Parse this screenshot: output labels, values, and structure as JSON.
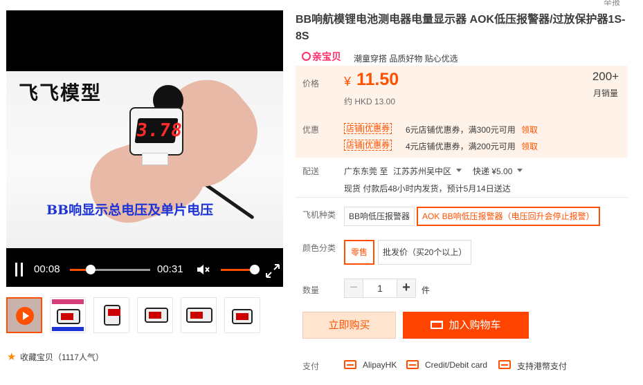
{
  "video": {
    "caption_top": "飞飞模型",
    "caption_bottom": "BB响显示总电压及单片电压",
    "display_reading": "3.78",
    "time_current": "00:08",
    "time_duration": "00:31",
    "progress_fraction": 0.26,
    "volume_fraction": 0.85
  },
  "thumbnails": [
    {
      "name": "video-thumb",
      "kind": "video"
    },
    {
      "name": "image-thumb-1"
    },
    {
      "name": "image-thumb-2"
    },
    {
      "name": "image-thumb-3"
    },
    {
      "name": "image-thumb-4"
    },
    {
      "name": "image-thumb-5"
    }
  ],
  "favorite": {
    "icon": "star-icon",
    "label": "收藏宝贝（1117人气）"
  },
  "top_cut_text": "举报",
  "product": {
    "title": "BB响航模锂电池测电器电量显示器 AOK低压报警器/过放保护器1S-8S",
    "brand_logo": "亲宝贝",
    "brand_slogan": "潮童穿搭 品质好物 贴心优选"
  },
  "price": {
    "label": "价格",
    "symbol": "¥",
    "value": "11.50",
    "hkd": "约 HKD 13.00",
    "sales_count": "200+",
    "sales_label": "月销量"
  },
  "coupons": {
    "label": "优惠",
    "items": [
      {
        "tag": "店铺|优惠券",
        "text": "6元店铺优惠券，满300元可用",
        "action": "领取"
      },
      {
        "tag": "店铺|优惠券",
        "text": "4元店铺优惠券，满200元可用",
        "action": "领取"
      }
    ]
  },
  "shipping": {
    "label": "配送",
    "from": "广东东莞 至",
    "to": "江苏苏州吴中区",
    "express": "快递 ¥5.00",
    "note": "现货 付款后48小时内发货，预计5月14日送达"
  },
  "options": {
    "model_label": "飞机种类",
    "models": [
      "BB响低压报警器",
      "AOK BB响低压报警器（电压回升会停止报警）"
    ],
    "model_selected": 1,
    "color_label": "颜色分类",
    "colors": [
      "零售",
      "批发价（买20个以上）"
    ],
    "color_selected": 0
  },
  "quantity": {
    "label": "数量",
    "value": "1",
    "minus": "−",
    "plus": "+",
    "unit": "件"
  },
  "actions": {
    "buy_now": "立即购买",
    "add_cart": "加入购物车"
  },
  "payment": {
    "label": "支付",
    "methods": [
      "AlipayHK",
      "Credit/Debit card",
      "支持港幣支付"
    ]
  },
  "colors": {
    "accent": "#ff5000",
    "price_bg": "#fff2e8",
    "cart_bg": "#ff4400"
  }
}
